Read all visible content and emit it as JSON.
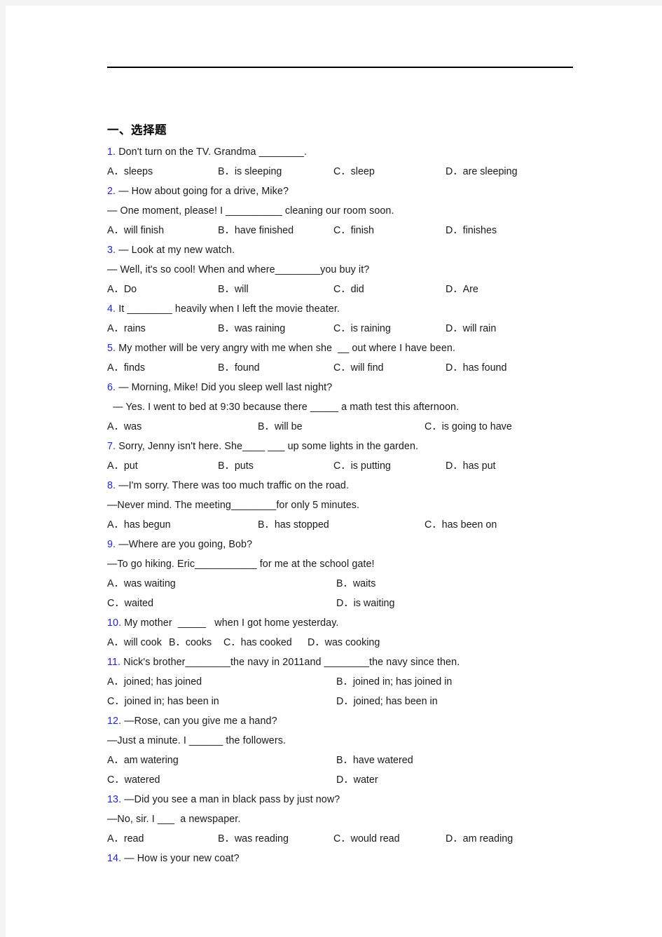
{
  "document": {
    "section_title": "一、选择题",
    "accent_color": "#2323dd",
    "text_color": "#1a1a1a",
    "questions": [
      {
        "num": "1.",
        "stem": " Don't turn on the TV. Grandma ________.",
        "layout": "row4",
        "options": [
          "A．sleeps",
          "B．is sleeping",
          "C．sleep",
          "D．are sleeping"
        ]
      },
      {
        "num": "2.",
        "stem": " — How about going for a drive, Mike?",
        "stem2": "— One moment, please! I __________ cleaning our room soon.",
        "layout": "row4",
        "options": [
          "A．will finish",
          "B．have finished",
          "C．finish",
          "D．finishes"
        ]
      },
      {
        "num": "3.",
        "stem": " — Look at my new watch.",
        "stem2": "— Well, it's so cool! When and where________you buy it?",
        "layout": "row4",
        "options": [
          "A．Do",
          "B．will",
          "C．did",
          "D．Are"
        ]
      },
      {
        "num": "4.",
        "stem": " It ________ heavily when I left the movie theater.",
        "layout": "row4",
        "options": [
          "A．rains",
          "B．was raining",
          "C．is raining",
          "D．will rain"
        ]
      },
      {
        "num": "5.",
        "stem": " My mother will be very angry with me when she  __ out where I have been.",
        "layout": "row4",
        "options": [
          "A．finds",
          "B．found",
          "C．will find",
          "D．has found"
        ]
      },
      {
        "num": "6.",
        "stem": " — Morning, Mike! Did you sleep well last night?",
        "stem2": "  — Yes. I went to bed at 9:30 because there _____ a math test this afternoon.",
        "layout": "row3",
        "options": [
          "A．was",
          "B．will be",
          "C．is going to have"
        ]
      },
      {
        "num": "7.",
        "stem": " Sorry, Jenny isn't here. She____ ___ up some lights in the garden.",
        "layout": "row4",
        "options": [
          "A．put",
          "B．puts",
          "C．is putting",
          "D．has put"
        ]
      },
      {
        "num": "8.",
        "stem": " —I'm sorry. There was too much traffic on the road.",
        "stem2": "—Never mind. The meeting________for only 5 minutes.",
        "layout": "row3",
        "options": [
          "A．has begun",
          "B．has stopped",
          "C．has been on"
        ]
      },
      {
        "num": "9.",
        "stem": " —Where are you going, Bob?",
        "stem2": "—To go hiking. Eric___________ for me at the school gate!",
        "layout": "row2x2",
        "options": [
          "A．was waiting",
          "B．waits",
          "C．waited",
          "D．is waiting"
        ]
      },
      {
        "num": "10.",
        "stem": " My mother  _____   when I got home yesterday.",
        "layout": "row4tight",
        "options": [
          "A．will cook",
          "B．cooks",
          "C．has cooked",
          "D．was cooking"
        ]
      },
      {
        "num": "11.",
        "stem": " Nick's brother________the navy in 2011and ________the navy since then.",
        "layout": "row2x2",
        "options": [
          "A．joined; has joined",
          "B．joined in; has joined in",
          "C．joined in; has been in",
          "D．joined; has been in"
        ]
      },
      {
        "num": "12.",
        "stem": " —Rose, can you give me a hand?",
        "stem2": "—Just a minute. I ______ the followers.",
        "layout": "row2x2",
        "options": [
          "A．am watering",
          "B．have watered",
          "C．watered",
          "D．water"
        ]
      },
      {
        "num": "13.",
        "stem": " —Did you see a man in black pass by just now?",
        "stem2": "—No, sir. I ___  a newspaper.",
        "layout": "row4",
        "options": [
          "A．read",
          "B．was reading",
          "C．would read",
          "D．am reading"
        ]
      },
      {
        "num": "14.",
        "stem": " — How is your new coat?",
        "layout": "none",
        "options": []
      }
    ]
  }
}
